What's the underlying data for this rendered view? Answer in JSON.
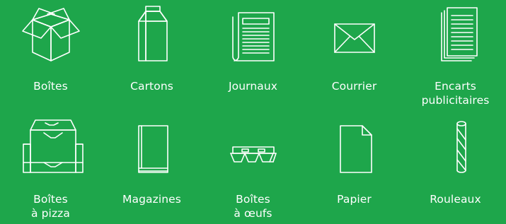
{
  "background_color": "#1ea64b",
  "icon_color": "#ffffff",
  "items": [
    {
      "label": "Boîtes",
      "icon": "open-box-icon"
    },
    {
      "label": "Cartons",
      "icon": "milk-carton-icon"
    },
    {
      "label": "Journaux",
      "icon": "newspaper-icon"
    },
    {
      "label": "Courrier",
      "icon": "envelope-icon"
    },
    {
      "label": "Encarts\npublicitaires",
      "icon": "flyers-stack-icon"
    },
    {
      "label": "Boîtes\nà pizza",
      "icon": "pizza-box-icon"
    },
    {
      "label": "Magazines",
      "icon": "magazine-icon"
    },
    {
      "label": "Boîtes\nà œufs",
      "icon": "egg-carton-icon"
    },
    {
      "label": "Papier",
      "icon": "paper-sheet-icon"
    },
    {
      "label": "Rouleaux",
      "icon": "paper-roll-icon"
    }
  ]
}
